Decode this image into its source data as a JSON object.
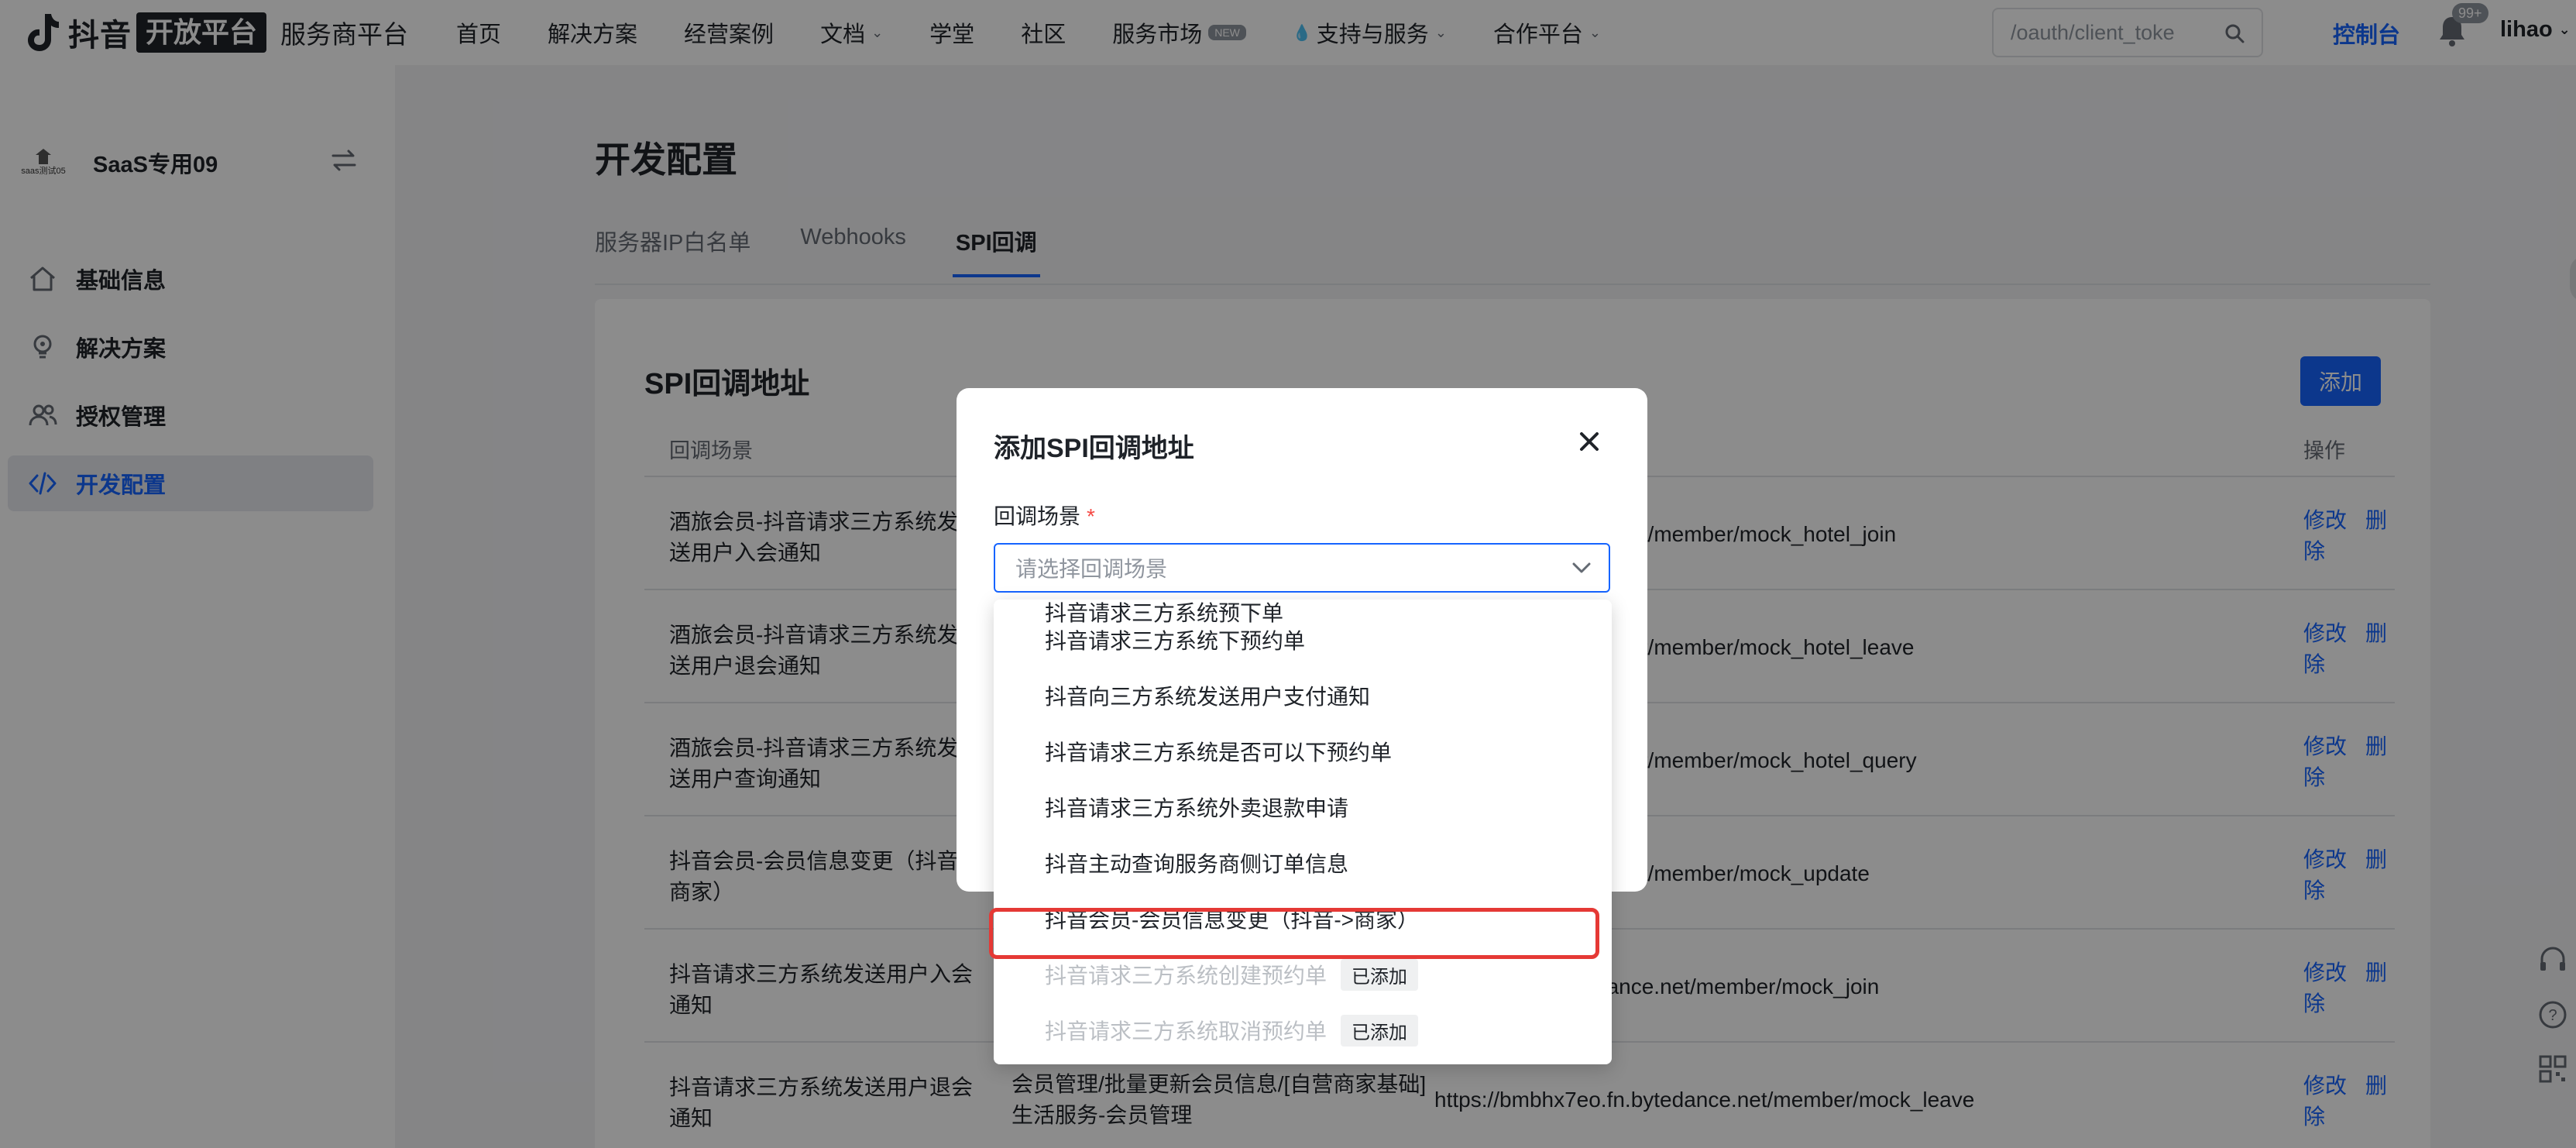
{
  "brand": {
    "douyin": "抖音",
    "box": "开放平台",
    "sub": "服务商平台"
  },
  "nav": {
    "items": [
      {
        "label": "首页"
      },
      {
        "label": "解决方案"
      },
      {
        "label": "经营案例"
      },
      {
        "label": "文档",
        "chevron": true
      },
      {
        "label": "学堂"
      },
      {
        "label": "社区"
      },
      {
        "label": "服务市场",
        "badge": "NEW"
      },
      {
        "label": "支持与服务",
        "chevron": true,
        "icon": "drop-icon"
      },
      {
        "label": "合作平台",
        "chevron": true
      }
    ],
    "search_value": "/oauth/client_toke",
    "console": "控制台",
    "bell_badge": "99+",
    "user": "lihao"
  },
  "sidebar": {
    "org_name": "SaaS专用09",
    "org_avatar_text": "saas测试05",
    "items": [
      {
        "label": "基础信息",
        "icon": "home-icon",
        "active": false
      },
      {
        "label": "解决方案",
        "icon": "bulb-icon",
        "active": false
      },
      {
        "label": "授权管理",
        "icon": "users-icon",
        "active": false
      },
      {
        "label": "开发配置",
        "icon": "code-icon",
        "active": true
      }
    ]
  },
  "main": {
    "title": "开发配置",
    "tabs": [
      {
        "label": "服务器IP白名单",
        "active": false
      },
      {
        "label": "Webhooks",
        "active": false
      },
      {
        "label": "SPI回调",
        "active": true
      }
    ],
    "card_title": "SPI回调地址",
    "add_label": "添加",
    "table": {
      "headers": {
        "scene": "回调场景",
        "op": "操作"
      },
      "rows": [
        {
          "scene": "酒旅会员-抖音请求三方系统发送用户入会通知",
          "desc": "",
          "url": "x7eo.fn.bytedance.net/member/mock_hotel_join",
          "edit": "修改",
          "delete": "删除"
        },
        {
          "scene": "酒旅会员-抖音请求三方系统发送用户退会通知",
          "desc": "",
          "url": "x7eo.fn.bytedance.net/member/mock_hotel_leave",
          "edit": "修改",
          "delete": "删除"
        },
        {
          "scene": "酒旅会员-抖音请求三方系统发送用户查询通知",
          "desc": "",
          "url": "x7eo.fn.bytedance.net/member/mock_hotel_query",
          "edit": "修改",
          "delete": "删除"
        },
        {
          "scene": "抖音会员-会员信息变更（抖音->商家）",
          "desc": "",
          "url": "x7eo.fn.bytedance.net/member/mock_update",
          "edit": "修改",
          "delete": "删除"
        },
        {
          "scene": "抖音请求三方系统发送用户入会通知",
          "desc": "",
          "url": "mbhx7eo.fn.bytedance.net/member/mock_join",
          "edit": "修改",
          "delete": "删除"
        },
        {
          "scene": "抖音请求三方系统发送用户退会通知",
          "desc": "会员管理/批量更新会员信息/[自营商家基础]生活服务-会员管理",
          "url": "https://bmbhx7eo.fn.bytedance.net/member/mock_leave",
          "edit": "修改",
          "delete": "删除"
        }
      ]
    }
  },
  "modal": {
    "title": "添加SPI回调地址",
    "field_label": "回调场景",
    "required_mark": "*",
    "placeholder": "请选择回调场景",
    "options": [
      {
        "label": "抖音请求三方系统预下单",
        "disabled": false,
        "partial": true
      },
      {
        "label": "抖音请求三方系统下预约单",
        "disabled": false
      },
      {
        "label": "抖音向三方系统发送用户支付通知",
        "disabled": false
      },
      {
        "label": "抖音请求三方系统是否可以下预约单",
        "disabled": false
      },
      {
        "label": "抖音请求三方系统外卖退款申请",
        "disabled": false
      },
      {
        "label": "抖音主动查询服务商侧订单信息",
        "disabled": false
      },
      {
        "label": "抖音会员-会员信息变更（抖音->商家）",
        "disabled": false,
        "highlighted": true
      },
      {
        "label": "抖音请求三方系统创建预约单",
        "disabled": true,
        "tag": "已添加"
      },
      {
        "label": "抖音请求三方系统取消预约单",
        "disabled": true,
        "tag": "已添加"
      }
    ]
  },
  "colors": {
    "accent": "#1664ff",
    "highlight": "#e53935",
    "required": "#f54a45"
  }
}
